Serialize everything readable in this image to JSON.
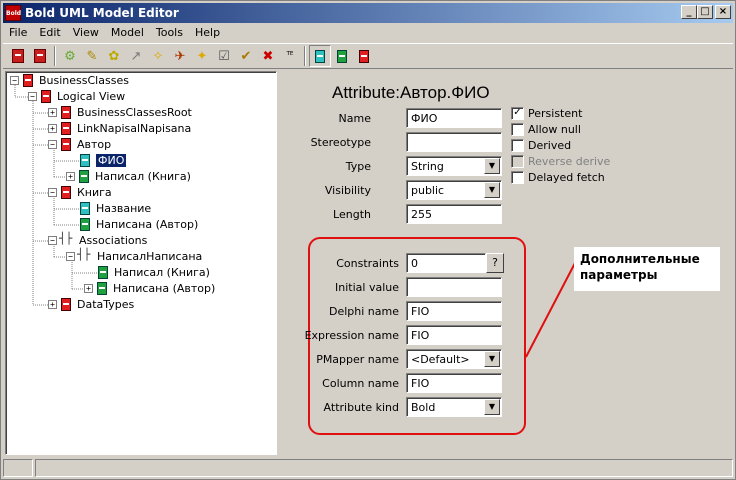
{
  "window": {
    "title": "Bold UML Model Editor",
    "app_icon_text": "Bold",
    "minimize": "_",
    "maximize": "□",
    "close": "×"
  },
  "menu": [
    "File",
    "Edit",
    "View",
    "Model",
    "Tools",
    "Help"
  ],
  "tree": {
    "nodes": [
      {
        "label": "BusinessClasses",
        "expander": "−",
        "icon": "red"
      },
      {
        "label": "Logical View",
        "expander": "−",
        "icon": "red"
      },
      {
        "label": "BusinessClassesRoot",
        "expander": "+",
        "icon": "red"
      },
      {
        "label": "LinkNapisalNapisana",
        "expander": "+",
        "icon": "red"
      },
      {
        "label": "Автор",
        "expander": "−",
        "icon": "red"
      },
      {
        "label": "ФИО",
        "expander": "",
        "icon": "cyan",
        "selected": true
      },
      {
        "label": "Написал (Книга)",
        "expander": "+",
        "icon": "green"
      },
      {
        "label": "Книга",
        "expander": "−",
        "icon": "red"
      },
      {
        "label": "Название",
        "expander": "",
        "icon": "cyan"
      },
      {
        "label": "Написана (Автор)",
        "expander": "",
        "icon": "green"
      },
      {
        "label": "Associations",
        "expander": "−",
        "icon": "assoc"
      },
      {
        "label": "НаписалНаписана",
        "expander": "−",
        "icon": "assoc"
      },
      {
        "label": "Написал (Книга)",
        "expander": "",
        "icon": "green"
      },
      {
        "label": "Написана (Автор)",
        "expander": "+",
        "icon": "green"
      },
      {
        "label": "DataTypes",
        "expander": "+",
        "icon": "red"
      }
    ]
  },
  "detail": {
    "title": "Attribute:Автор.ФИО",
    "labels": {
      "name": "Name",
      "stereotype": "Stereotype",
      "type": "Type",
      "visibility": "Visibility",
      "length": "Length",
      "constraints": "Constraints",
      "initial_value": "Initial value",
      "delphi_name": "Delphi name",
      "expression_name": "Expression name",
      "pmapper_name": "PMapper name",
      "column_name": "Column name",
      "attribute_kind": "Attribute kind"
    },
    "values": {
      "name": "ФИО",
      "stereotype": "",
      "type": "String",
      "visibility": "public",
      "length": "255",
      "constraints": "0",
      "initial_value": "",
      "delphi_name": "FIO",
      "expression_name": "FIO",
      "pmapper_name": "<Default>",
      "column_name": "FIO",
      "attribute_kind": "Bold"
    },
    "constraints_button": "?",
    "checkboxes": {
      "persistent": {
        "label": "Persistent",
        "checked": true
      },
      "allow_null": {
        "label": "Allow null",
        "checked": false
      },
      "derived": {
        "label": "Derived",
        "checked": false
      },
      "reverse_derive": {
        "label": "Reverse derive",
        "checked": false,
        "disabled": true
      },
      "delayed_fetch": {
        "label": "Delayed fetch",
        "checked": false
      }
    },
    "annotation": "Дополнительные параметры",
    "annotation_color": "#e01010"
  }
}
